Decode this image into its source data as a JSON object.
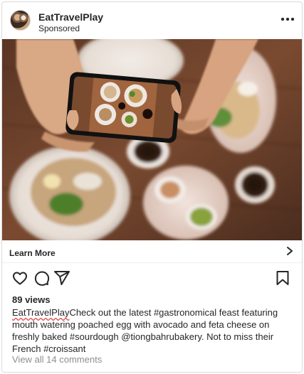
{
  "header": {
    "username": "EatTravelPlay",
    "subtitle": "Sponsored",
    "avatar_icon": "avatar-food-icon",
    "more_icon": "more-horizontal-icon"
  },
  "post_image": {
    "description_icon": "food-photo"
  },
  "cta": {
    "label": "Learn More",
    "icon": "chevron-right-icon"
  },
  "actions": {
    "like_icon": "heart-icon",
    "comment_icon": "comment-icon",
    "share_icon": "send-icon",
    "save_icon": "bookmark-icon"
  },
  "stats": {
    "views": "89 views"
  },
  "caption": {
    "username": "EatTravelPlay",
    "text": "Check out the latest #gastronomical feast featuring mouth watering poached egg with avocado and feta cheese on freshly baked #sourdough @tiongbahrubakery. Not to miss their French #croissant"
  },
  "comments": {
    "label": "View all 14 comments"
  },
  "colors": {
    "text": "#262626",
    "muted": "#8e8e8e",
    "border": "#dbdbdb"
  }
}
